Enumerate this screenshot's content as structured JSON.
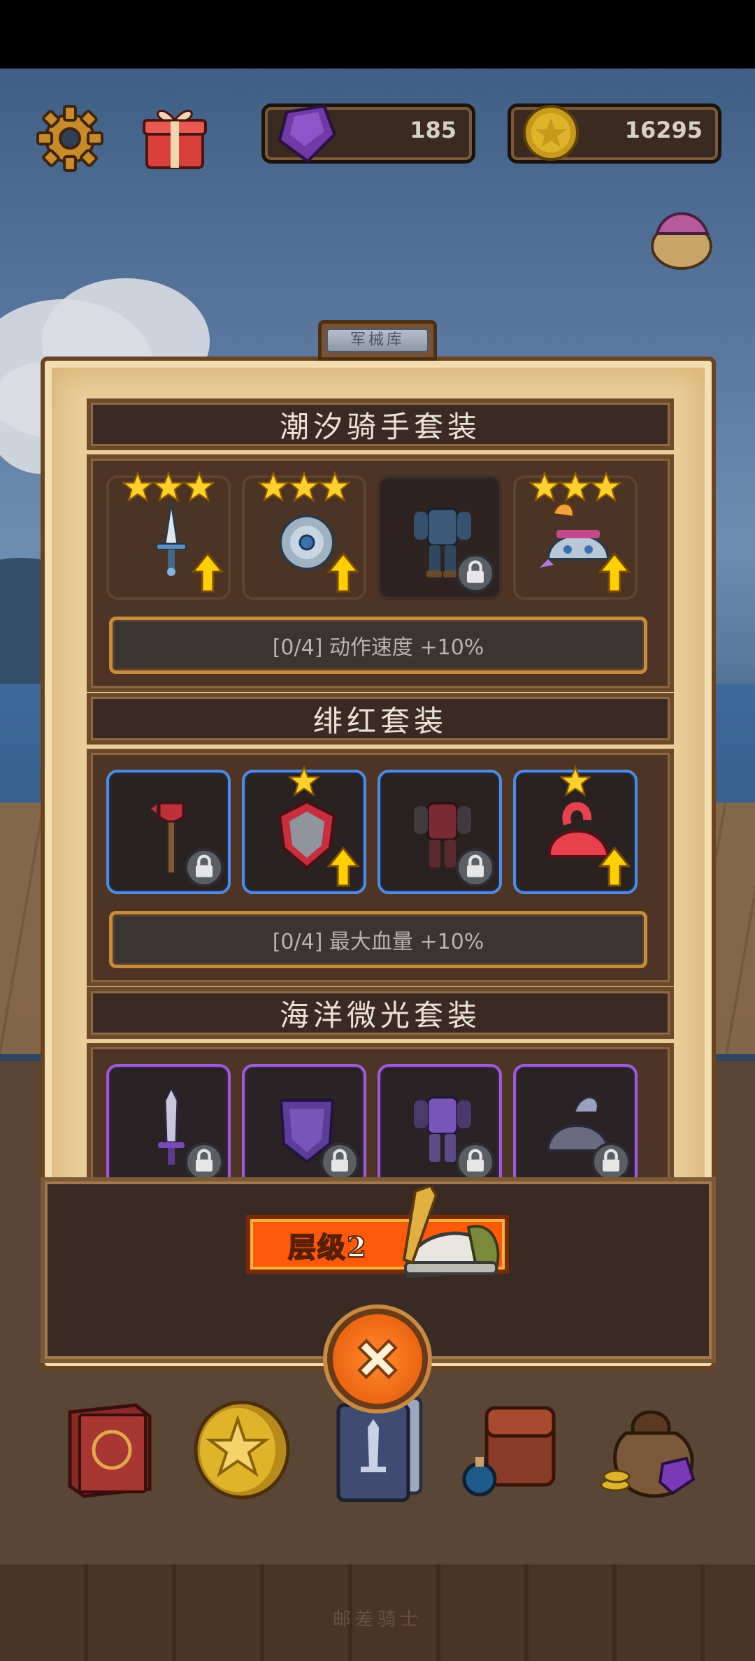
{
  "hud": {
    "gems": "185",
    "coins": "16295"
  },
  "panel": {
    "tab_label": "军械库",
    "sets": [
      {
        "name": "潮汐骑手套装",
        "bonus": "[0/4] 动作速度 +10%",
        "slots": [
          {
            "icon": "dagger-icon",
            "stars": 3,
            "locked": false,
            "upgrade": true,
            "style": "normal"
          },
          {
            "icon": "round-shield-icon",
            "stars": 3,
            "locked": false,
            "upgrade": true,
            "style": "normal"
          },
          {
            "icon": "armor-icon",
            "stars": 0,
            "locked": true,
            "upgrade": false,
            "style": "dark"
          },
          {
            "icon": "helmet-icon",
            "stars": 3,
            "locked": false,
            "upgrade": true,
            "style": "normal"
          }
        ]
      },
      {
        "name": "绯红套装",
        "bonus": "[0/4] 最大血量 +10%",
        "slots": [
          {
            "icon": "mace-icon",
            "stars": 0,
            "locked": true,
            "upgrade": false,
            "style": "blue"
          },
          {
            "icon": "shield-icon",
            "stars": 1,
            "locked": false,
            "upgrade": true,
            "style": "blue"
          },
          {
            "icon": "armor-icon",
            "stars": 0,
            "locked": true,
            "upgrade": false,
            "style": "blue"
          },
          {
            "icon": "helmet-icon",
            "stars": 1,
            "locked": false,
            "upgrade": true,
            "style": "blue"
          }
        ]
      },
      {
        "name": "海洋微光套装",
        "bonus": "",
        "slots": [
          {
            "icon": "sword-icon",
            "stars": 0,
            "locked": true,
            "upgrade": false,
            "style": "purple"
          },
          {
            "icon": "shield-icon",
            "stars": 0,
            "locked": true,
            "upgrade": false,
            "style": "purple"
          },
          {
            "icon": "armor-icon",
            "stars": 0,
            "locked": true,
            "upgrade": false,
            "style": "purple"
          },
          {
            "icon": "helmet-icon",
            "stars": 0,
            "locked": true,
            "upgrade": false,
            "style": "purple"
          }
        ]
      }
    ]
  },
  "level": {
    "label": "层级2"
  },
  "footer": "邮差骑士",
  "nav": [
    "book-icon",
    "star-coin-icon",
    "card-deck-icon",
    "backpack-icon",
    "loot-bag-icon"
  ]
}
